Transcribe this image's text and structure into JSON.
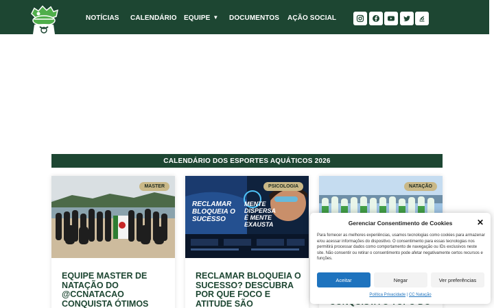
{
  "nav": {
    "items": [
      {
        "label": "NOTÍCIAS"
      },
      {
        "label": "CALENDÁRIO"
      },
      {
        "label": "EQUIPE",
        "has_dropdown": true
      },
      {
        "label": "DOCUMENTOS"
      },
      {
        "label": "AÇÃO SOCIAL"
      }
    ],
    "social_icons": [
      "instagram-icon",
      "facebook-icon",
      "youtube-icon",
      "twitter-icon",
      "custom-link-icon"
    ]
  },
  "banner": {
    "title": "CALENDÁRIO DOS ESPORTES AQUÁTICOS 2026"
  },
  "cards": [
    {
      "badge": "MASTER",
      "title": "EQUIPE MASTER DE NATAÇÃO DO @CCNATACAO CONQUISTA ÓTIMOS"
    },
    {
      "badge": "PSICOLOGIA",
      "title": "RECLAMAR BLOQUEIA O SUCESSO? DESCUBRA POR QUE FOCO E ATITUDE SÃO",
      "image_text": {
        "left": "RECLAMAR BLOQUEIA O SUCESSO",
        "right": "MENTE DISPERSA É MENTE EXAUSTA"
      }
    },
    {
      "badge": "NATAÇÃO",
      "title": "CONQUISTA O TOPO DO"
    }
  ],
  "cookie": {
    "title": "Gerenciar Consentimento de Cookies",
    "text": "Para fornecer as melhores experiências, usamos tecnologias como cookies para armazenar e/ou acessar informações do dispositivo. O consentimento para essas tecnologias nos permitirá processar dados como comportamento de navegação ou IDs exclusivos neste site. Não consentir ou retirar o consentimento pode afetar negativamente certos recursos e funções.",
    "accept": "Aceitar",
    "deny": "Negar",
    "preferences": "Ver preferências",
    "link_privacy": "Política Privacidade",
    "link_separator": " | ",
    "link_site": "CC Natação"
  },
  "colors": {
    "brand": "#1d4632",
    "badge": "#c9b887",
    "accept": "#1e73be"
  }
}
